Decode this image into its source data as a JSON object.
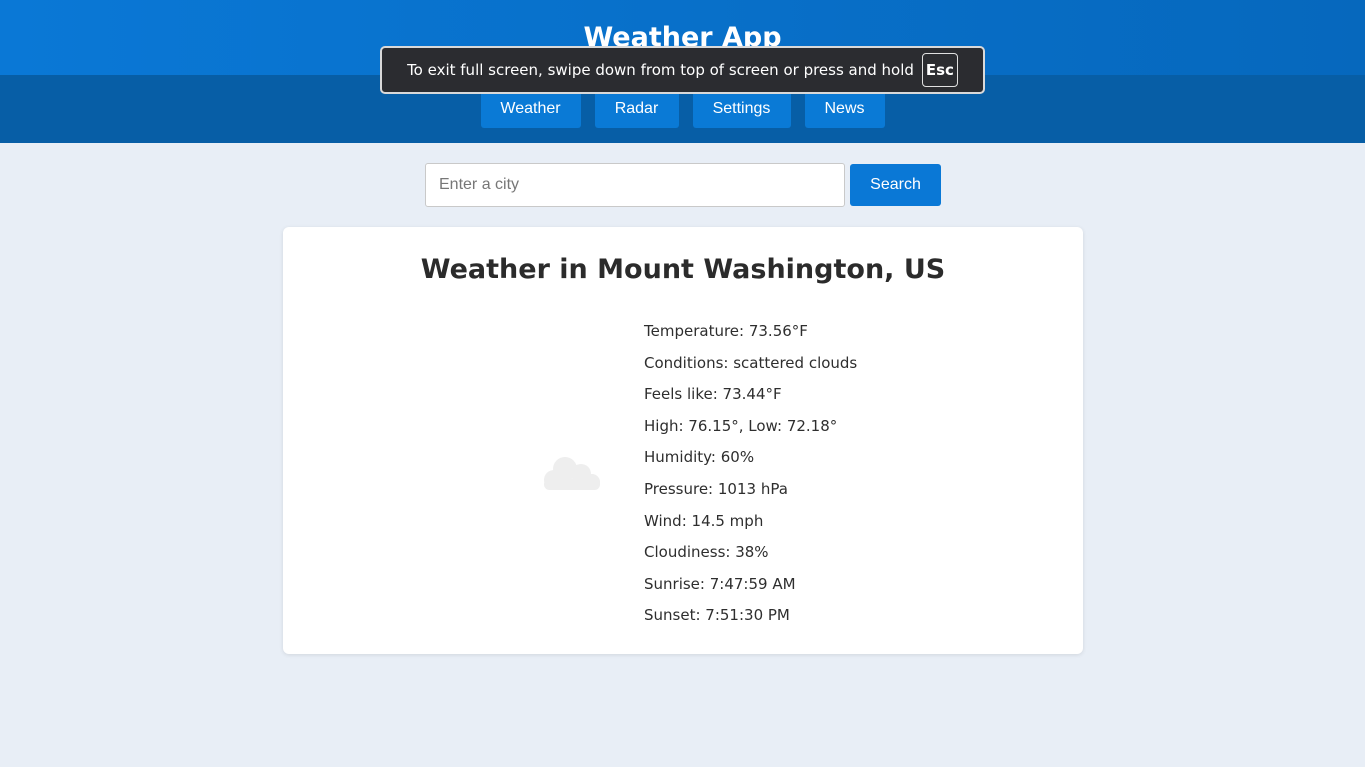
{
  "app": {
    "title": "Weather App"
  },
  "nav": [
    {
      "label": "Weather"
    },
    {
      "label": "Radar"
    },
    {
      "label": "Settings"
    },
    {
      "label": "News"
    }
  ],
  "fullscreen_toast": {
    "message": "To exit full screen, swipe down from top of screen or press and hold",
    "key": "Esc"
  },
  "search": {
    "placeholder": "Enter a city",
    "value": "",
    "button_label": "Search"
  },
  "weather": {
    "title": "Weather in Mount Washington, US",
    "icon": "cloud-icon",
    "details": [
      "Temperature: 73.56°F",
      "Conditions: scattered clouds",
      "Feels like: 73.44°F",
      "High: 76.15°, Low: 72.18°",
      "Humidity: 60%",
      "Pressure: 1013 hPa",
      "Wind: 14.5 mph",
      "Cloudiness: 38%",
      "Sunrise: 7:47:59 AM",
      "Sunset: 7:51:30 PM"
    ]
  },
  "colors": {
    "header_blue": "#0a78d6",
    "nav_button": "#0a7ad6",
    "page_bg": "#e8eef6",
    "card_bg": "#ffffff"
  }
}
